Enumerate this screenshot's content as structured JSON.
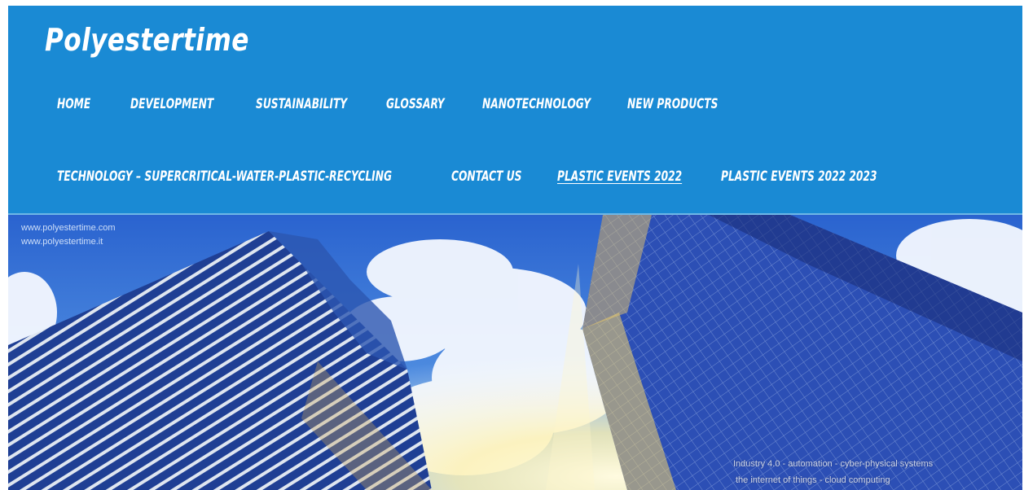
{
  "site": {
    "title": "Polyestertime"
  },
  "nav": {
    "items": [
      {
        "label": "HOME"
      },
      {
        "label": "DEVELOPMENT"
      },
      {
        "label": "SUSTAINABILITY"
      },
      {
        "label": "GLOSSARY"
      },
      {
        "label": "NANOTECHNOLOGY"
      },
      {
        "label": "NEW PRODUCTS"
      },
      {
        "label": "TECHNOLOGY – SUPERCRITICAL-WATER-PLASTIC-RECYCLING"
      },
      {
        "label": "CONTACT US"
      },
      {
        "label": "PLASTIC EVENTS 2022"
      },
      {
        "label": "PLASTIC EVENTS 2022 2023"
      }
    ]
  },
  "hero": {
    "watermark_line1": "www.polyestertime.com",
    "watermark_line2": "www.polyestertime.it",
    "caption_line1": "Industry 4.0 - automation - cyber-physical systems",
    "caption_line2": "the internet of things - cloud computing"
  },
  "colors": {
    "header_bg": "#1a8ad4",
    "nav_text": "#ffffff",
    "sky": "#2f6fd6"
  }
}
